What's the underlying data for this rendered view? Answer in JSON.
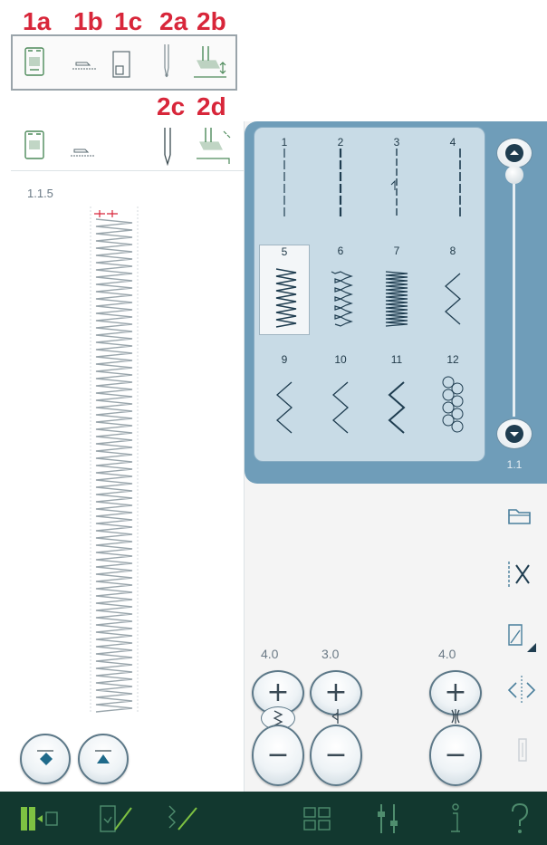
{
  "labels": {
    "top": [
      "1a",
      "1b",
      "1c",
      "2a",
      "2b"
    ],
    "mid": [
      "2c",
      "2d"
    ]
  },
  "preview": {
    "stitch_id": "1.1.5"
  },
  "stitch_menu": {
    "page_label": "1.1",
    "stitches": [
      {
        "num": "1",
        "type": "straight"
      },
      {
        "num": "2",
        "type": "straight-bold"
      },
      {
        "num": "3",
        "type": "straight-triple"
      },
      {
        "num": "4",
        "type": "straight-right"
      },
      {
        "num": "5",
        "type": "zigzag-wide",
        "selected": true
      },
      {
        "num": "6",
        "type": "zigzag-3step"
      },
      {
        "num": "7",
        "type": "zigzag-dense"
      },
      {
        "num": "8",
        "type": "zigzag-narrow"
      },
      {
        "num": "9",
        "type": "zigzag-open"
      },
      {
        "num": "10",
        "type": "zigzag-open"
      },
      {
        "num": "11",
        "type": "zigzag-open-bold"
      },
      {
        "num": "12",
        "type": "honeycomb"
      }
    ]
  },
  "adjust": {
    "width_value": "4.0",
    "length_value": "3.0",
    "position_value": "4.0",
    "plus": "+",
    "minus": "−"
  },
  "colors": {
    "panel_blue": "#6f9db9",
    "menu_blue": "#c8dbe6",
    "menu_border": "#87acc3",
    "toolbar_bg": "#12382f",
    "accent_green": "#7ec242",
    "red_labels": "#d8263a"
  },
  "icons": {
    "top_strip": [
      "sewing-machine-icon",
      "stitch-plate-icon",
      "bobbin-area-icon",
      "needle-icon",
      "presser-foot-icon"
    ],
    "side": [
      "folder-icon",
      "thread-cutter-icon",
      "edit-corner-icon",
      "mirror-icon",
      "lock-icon"
    ],
    "bottom": [
      "sewing-mode-icon",
      "embroidery-edit-icon",
      "stitch-creator-icon",
      "menu-grid-icon",
      "settings-icon",
      "info-icon",
      "help-icon"
    ]
  }
}
